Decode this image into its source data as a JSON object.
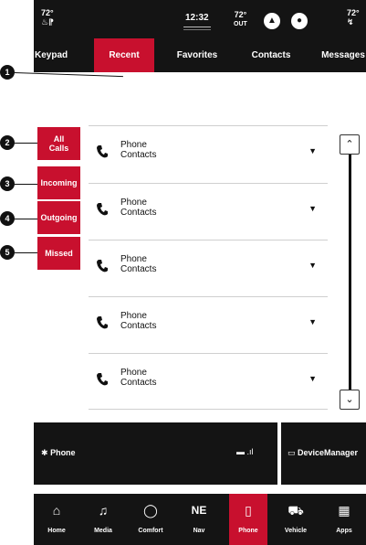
{
  "status_bar": {
    "left_temp": "72°",
    "clock": "12:32",
    "outside_temp": "72°",
    "outside_label": "OUT",
    "right_temp": "72°",
    "icons": [
      "seat-heat-icon",
      "profile-icon",
      "microphone-icon",
      "steering-heat-icon"
    ]
  },
  "tabs": [
    {
      "label": "Keypad",
      "active": false
    },
    {
      "label": "Recent",
      "active": true
    },
    {
      "label": "Favorites",
      "active": false
    },
    {
      "label": "Contacts",
      "active": false
    },
    {
      "label": "Messages",
      "active": false
    }
  ],
  "filters": [
    {
      "label": "All Calls"
    },
    {
      "label": "Incoming"
    },
    {
      "label": "Outgoing"
    },
    {
      "label": "Missed"
    }
  ],
  "calls": [
    {
      "name": "Phone Contacts"
    },
    {
      "name": "Phone Contacts"
    },
    {
      "name": "Phone Contacts"
    },
    {
      "name": "Phone Contacts"
    },
    {
      "name": "Phone Contacts"
    }
  ],
  "bottom_info": {
    "phone_label": "Phone",
    "device_manager_label": "DeviceManager"
  },
  "nav": [
    {
      "label": "Home",
      "icon": "home-icon",
      "active": false
    },
    {
      "label": "Media",
      "icon": "music-note-icon",
      "active": false
    },
    {
      "label": "Comfort",
      "icon": "comfort-icon",
      "active": false
    },
    {
      "label": "Nav",
      "icon": "compass-icon",
      "compass": "NE",
      "active": false
    },
    {
      "label": "Phone",
      "icon": "phone-icon",
      "active": true
    },
    {
      "label": "Vehicle",
      "icon": "car-icon",
      "active": false
    },
    {
      "label": "Apps",
      "icon": "apps-grid-icon",
      "active": false
    }
  ],
  "callouts": [
    "1",
    "2",
    "3",
    "4",
    "5"
  ],
  "colors": {
    "accent": "#c8102e",
    "bar": "#141414"
  }
}
